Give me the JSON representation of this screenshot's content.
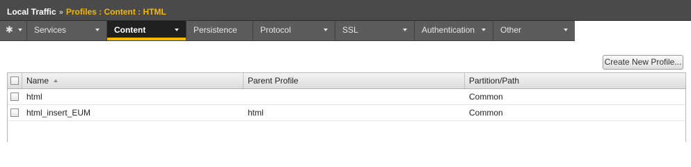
{
  "breadcrumb": {
    "root": "Local Traffic",
    "separator": "»",
    "current": "Profiles : Content : HTML"
  },
  "tabs": [
    {
      "label": "Services",
      "has_dropdown": true,
      "active": false
    },
    {
      "label": "Content",
      "has_dropdown": true,
      "active": true
    },
    {
      "label": "Persistence",
      "has_dropdown": false,
      "active": false
    },
    {
      "label": "Protocol",
      "has_dropdown": true,
      "active": false
    },
    {
      "label": "SSL",
      "has_dropdown": true,
      "active": false
    },
    {
      "label": "Authentication",
      "has_dropdown": true,
      "active": false
    },
    {
      "label": "Other",
      "has_dropdown": true,
      "active": false
    }
  ],
  "toolbar": {
    "create_label": "Create New Profile..."
  },
  "table": {
    "columns": [
      "Name",
      "Parent Profile",
      "Partition/Path"
    ],
    "sort_column": "Name",
    "rows": [
      {
        "name": "html",
        "parent": "",
        "partition": "Common"
      },
      {
        "name": "html_insert_EUM",
        "parent": "html",
        "partition": "Common"
      }
    ]
  },
  "colors": {
    "accent": "#f5b800",
    "header_bg": "#4a4a4a",
    "tabbar_bg": "#5c5c5c",
    "active_tab_bg": "#202020"
  }
}
